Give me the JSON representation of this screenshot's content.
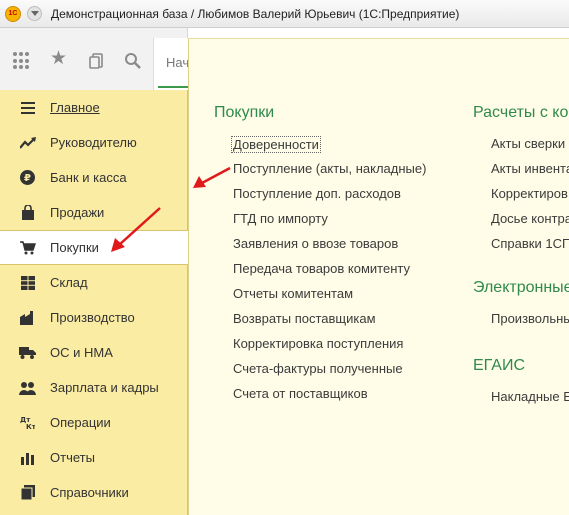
{
  "window": {
    "title": "Демонстрационная база / Любимов Валерий Юрьевич  (1С:Предприятие)",
    "logo_text": "1С"
  },
  "toolbar": {
    "icons": [
      "apps-grid-icon",
      "star-icon",
      "history-icon",
      "search-icon"
    ]
  },
  "tabs": {
    "home_label": "Нач"
  },
  "sidebar": {
    "items": [
      {
        "label": "Главное",
        "icon": "menu-lines-icon"
      },
      {
        "label": "Руководителю",
        "icon": "trend-up-icon"
      },
      {
        "label": "Банк и касса",
        "icon": "ruble-coin-icon"
      },
      {
        "label": "Продажи",
        "icon": "shopping-bag-icon"
      },
      {
        "label": "Покупки",
        "icon": "cart-icon"
      },
      {
        "label": "Склад",
        "icon": "warehouse-icon"
      },
      {
        "label": "Производство",
        "icon": "factory-icon"
      },
      {
        "label": "ОС и НМА",
        "icon": "truck-icon"
      },
      {
        "label": "Зарплата и кадры",
        "icon": "people-icon"
      },
      {
        "label": "Операции",
        "icon": "debit-credit-icon"
      },
      {
        "label": "Отчеты",
        "icon": "bar-chart-icon"
      },
      {
        "label": "Справочники",
        "icon": "books-icon"
      }
    ]
  },
  "panel": {
    "purchases": {
      "title": "Покупки",
      "links": [
        "Доверенности",
        "Поступление (акты, накладные)",
        "Поступление доп. расходов",
        "ГТД по импорту",
        "Заявления о ввозе товаров",
        "Передача товаров комитенту",
        "Отчеты комитентам",
        "Возвраты поставщикам",
        "Корректировка поступления",
        "Счета-фактуры полученные",
        "Счета от поставщиков"
      ]
    },
    "settlements": {
      "title": "Расчеты с ко",
      "links": [
        "Акты сверки",
        "Акты инвента",
        "Корректиров",
        "Досье контра",
        "Справки 1СП"
      ]
    },
    "electronic": {
      "title": "Электронные",
      "links": [
        "Произвольны"
      ]
    },
    "egais": {
      "title": "ЕГАИС",
      "links": [
        "Накладные Е"
      ]
    }
  },
  "colors": {
    "sidebar_bg": "#fbeca4",
    "panel_bg": "#fffde8",
    "section_title": "#2f8a4b",
    "arrow": "#e0191b"
  }
}
